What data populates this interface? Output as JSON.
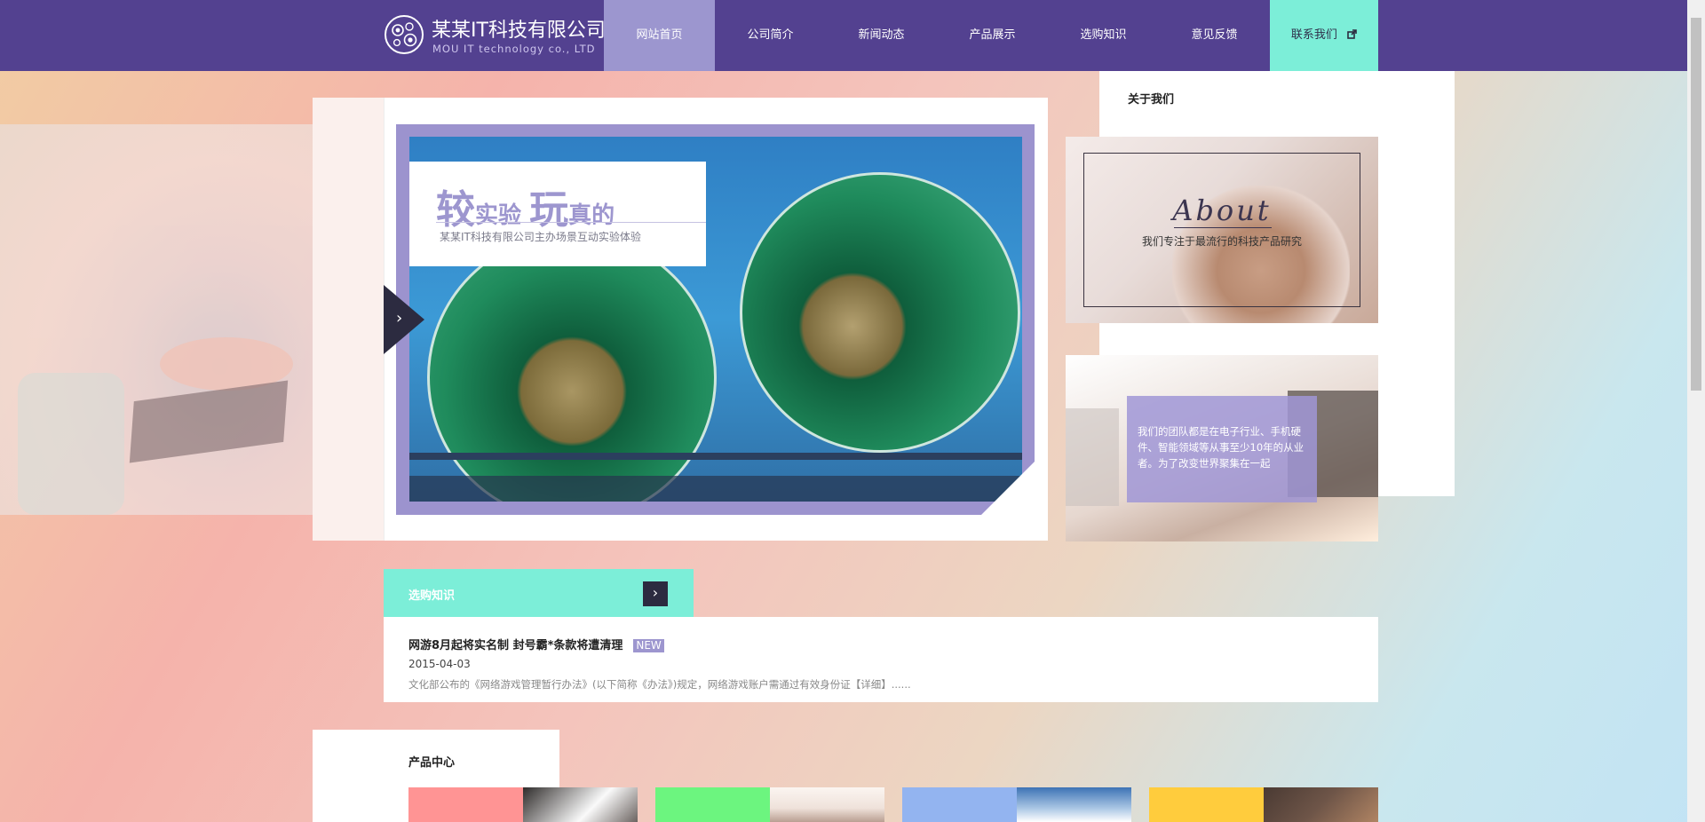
{
  "brand": {
    "name": "某某IT科技有限公司",
    "subtitle": "MOU IT technology co., LTD"
  },
  "nav": {
    "items": [
      {
        "label": "网站首页",
        "active": true
      },
      {
        "label": "公司简介"
      },
      {
        "label": "新闻动态"
      },
      {
        "label": "产品展示"
      },
      {
        "label": "选购知识"
      },
      {
        "label": "意见反馈"
      }
    ],
    "contact": {
      "label": "联系我们",
      "icon": "external-link-icon"
    }
  },
  "banner": {
    "title_big1": "较",
    "title_small1": "实验",
    "title_big2": "玩",
    "title_small2": "真的",
    "subtitle": "某某IT科技有限公司主办场景互动实验体验",
    "next_icon": "chevron-right-icon"
  },
  "about": {
    "heading": "关于我们",
    "word": "About",
    "desc": "我们专注于最流行的科技产品研究",
    "team_text": "我们的团队都是在电子行业、手机硬件、智能领域等从事至少10年的从业者。为了改变世界聚集在一起"
  },
  "knowledge": {
    "label": "选购知识",
    "news": {
      "title": "网游8月起将实名制 封号霸*条款将遭清理",
      "badge": "NEW",
      "date": "2015-04-03",
      "desc": "文化部公布的《网络游戏管理暂行办法》(以下简称《办法》)规定，网络游戏账户需通过有效身份证【详细】......"
    }
  },
  "products": {
    "heading": "产品中心",
    "cards": [
      {
        "color": "#ff9494"
      },
      {
        "color": "#6cf57f"
      },
      {
        "color": "#93b4f0"
      },
      {
        "color": "#ffcc3d"
      }
    ]
  },
  "colors": {
    "header": "#534190",
    "nav_active": "#9c96cf",
    "accent": "#7ceed8",
    "dark": "#2c2b40"
  }
}
